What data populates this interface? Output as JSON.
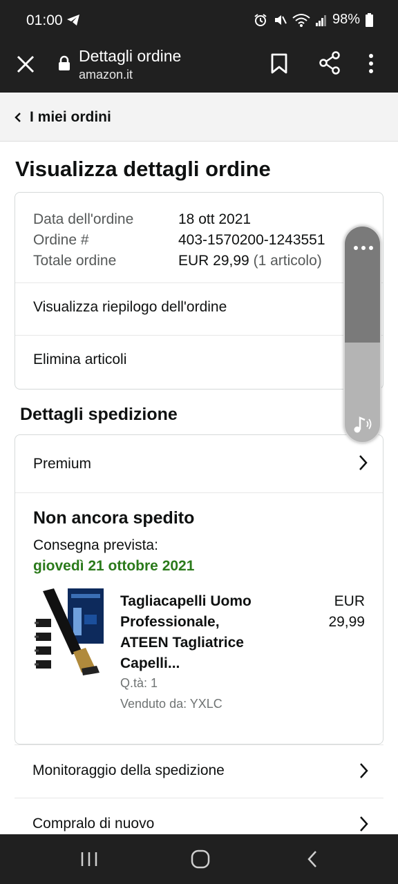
{
  "status_bar": {
    "time": "01:00",
    "battery": "98%"
  },
  "browser": {
    "title": "Dettagli ordine",
    "url": "amazon.it"
  },
  "breadcrumb": {
    "label": "I miei ordini"
  },
  "page": {
    "title": "Visualizza dettagli ordine"
  },
  "order_summary": {
    "date_label": "Data dell'ordine",
    "date_value": "18 ott 2021",
    "number_label": "Ordine #",
    "number_value": "403-1570200-1243551",
    "total_label": "Totale ordine",
    "total_value": "EUR 29,99",
    "total_items": "(1 articolo)",
    "view_summary_label": "Visualizza riepilogo dell'ordine",
    "delete_items_label": "Elimina articoli"
  },
  "shipment": {
    "section_title": "Dettagli spedizione",
    "shipping_type": "Premium",
    "status": "Non ancora spedito",
    "delivery_label": "Consegna prevista:",
    "delivery_date": "giovedì 21 ottobre 2021",
    "product": {
      "title_line1": "Tagliacapelli Uomo",
      "title_line2": "Professionale,",
      "title_line3": "ATEEN Tagliatrice",
      "title_line4": "Capelli...",
      "price_currency": "EUR",
      "price_amount": "29,99",
      "quantity": "Q.tà: 1",
      "seller": "Venduto da: YXLC"
    }
  },
  "actions": {
    "track_label": "Monitoraggio della spedizione",
    "buy_again_label": "Compralo di nuovo"
  },
  "colors": {
    "delivery_green": "#2b7a1b",
    "bar_background": "#202020"
  }
}
